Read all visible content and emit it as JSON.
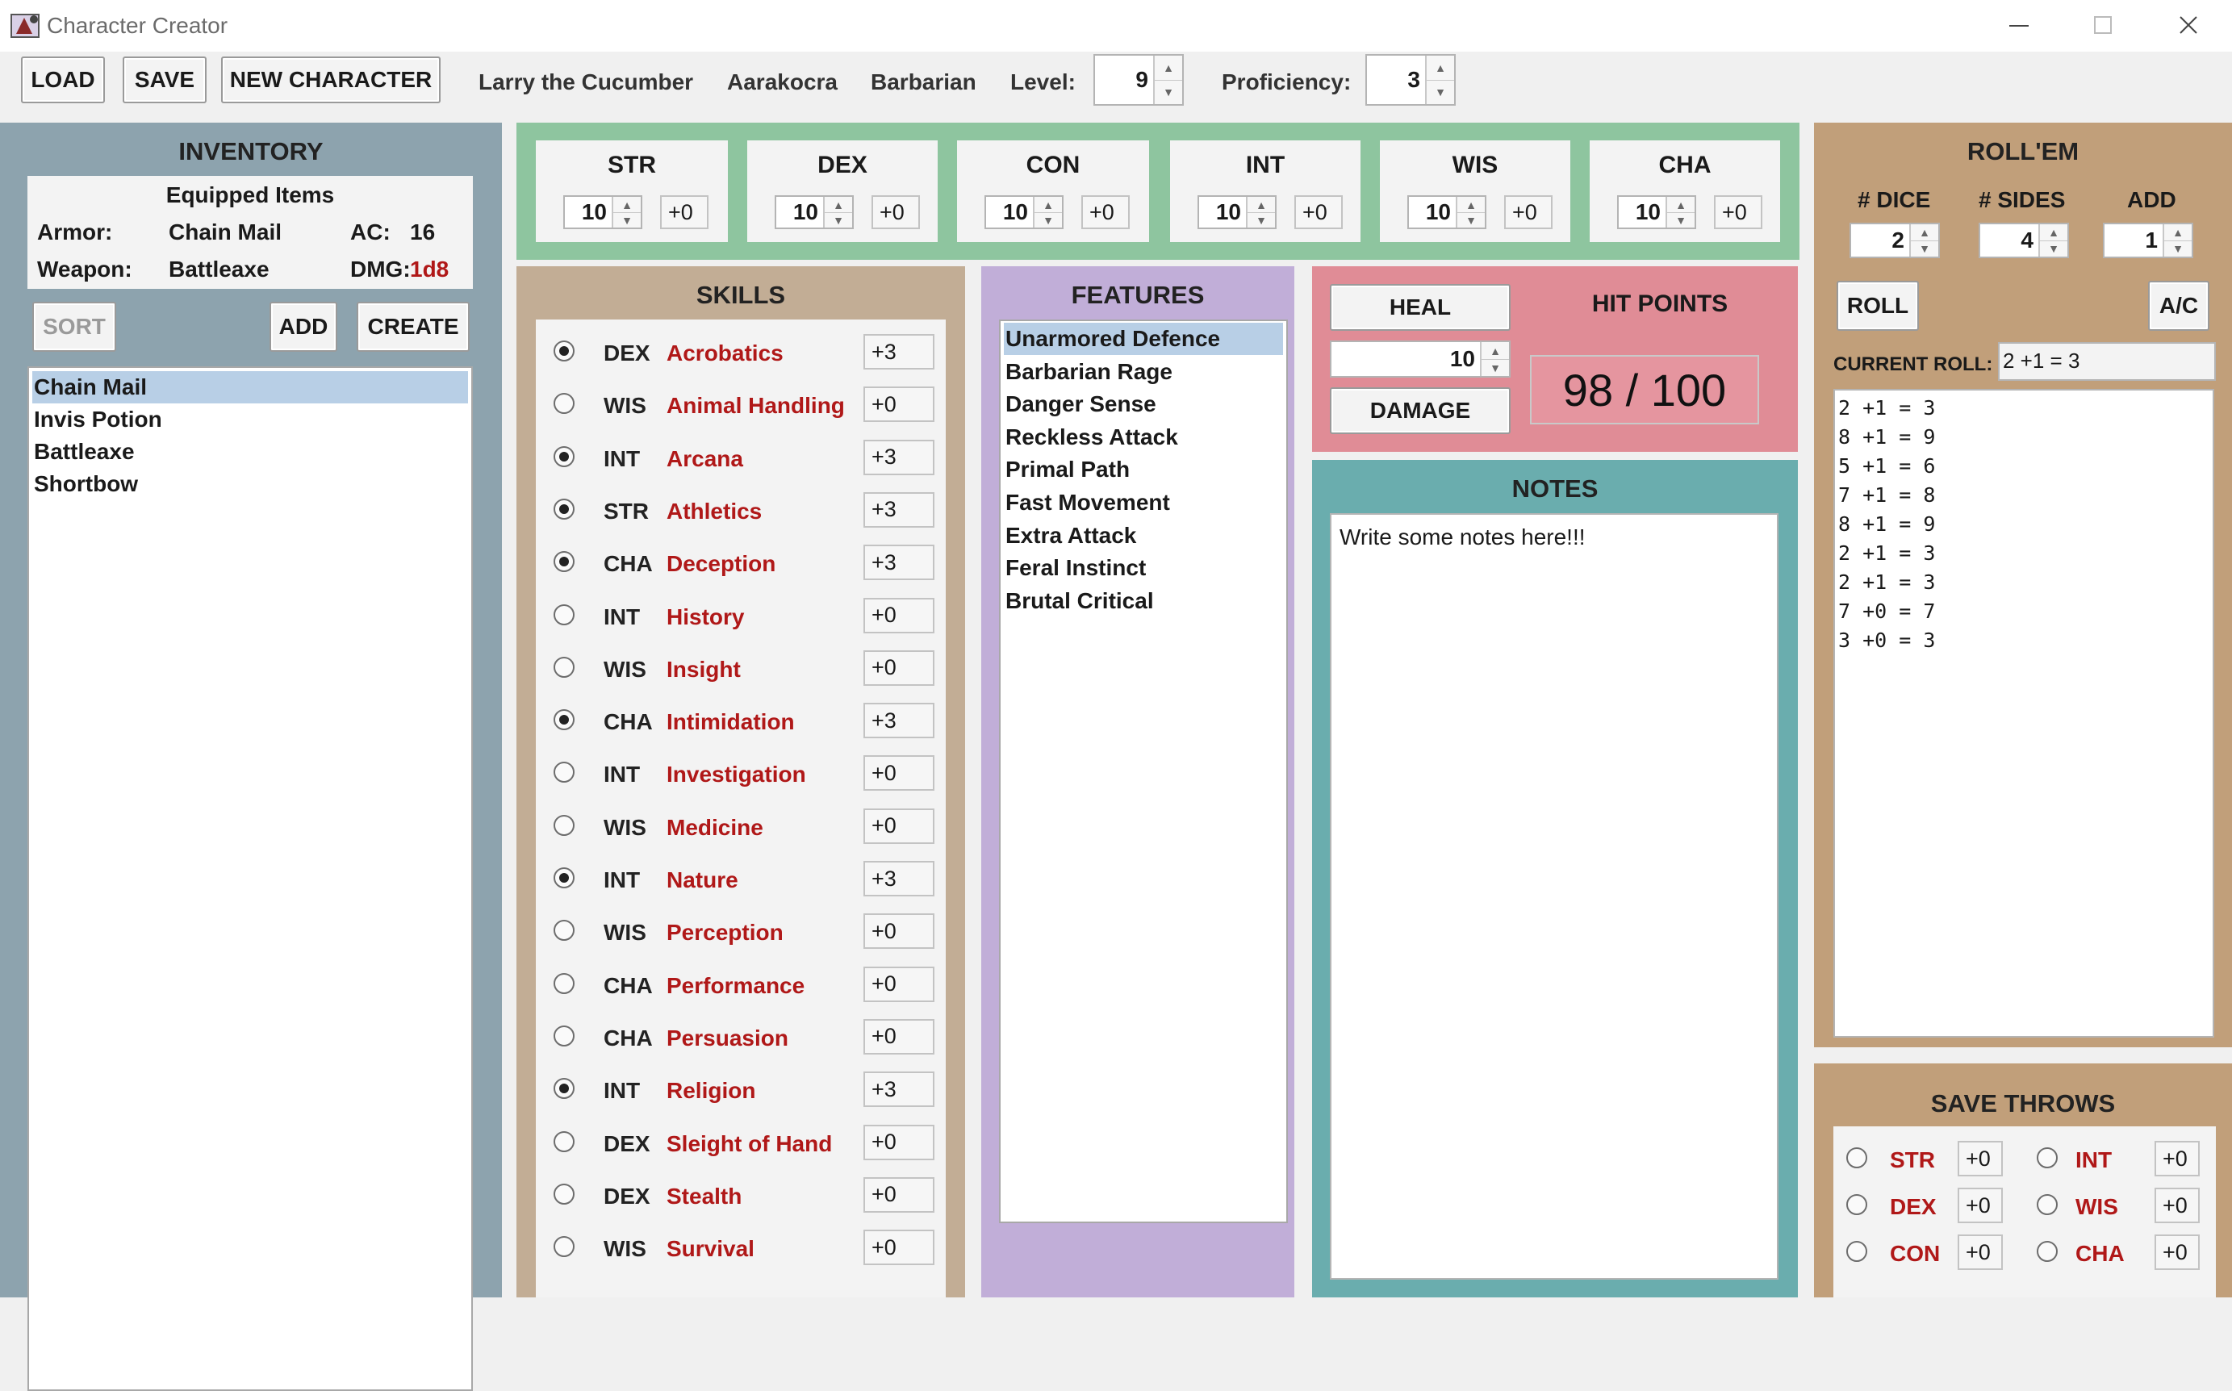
{
  "window": {
    "title": "Character Creator"
  },
  "toolbar": {
    "load": "LOAD",
    "save": "SAVE",
    "new_character": "NEW CHARACTER",
    "name": "Larry the Cucumber",
    "race": "Aarakocra",
    "class": "Barbarian",
    "level_label": "Level:",
    "level": "9",
    "proficiency_label": "Proficiency:",
    "proficiency": "3"
  },
  "inventory": {
    "title": "INVENTORY",
    "equipped_title": "Equipped Items",
    "armor_label": "Armor:",
    "armor": "Chain Mail",
    "ac_label": "AC:",
    "ac": "16",
    "weapon_label": "Weapon:",
    "weapon": "Battleaxe",
    "dmg_label": "DMG:",
    "dmg": "1d8",
    "sort": "SORT",
    "add": "ADD",
    "create": "CREATE",
    "items": [
      "Chain Mail",
      "Invis Potion",
      "Battleaxe",
      "Shortbow"
    ]
  },
  "stats": [
    {
      "name": "STR",
      "value": "10",
      "mod": "+0"
    },
    {
      "name": "DEX",
      "value": "10",
      "mod": "+0"
    },
    {
      "name": "CON",
      "value": "10",
      "mod": "+0"
    },
    {
      "name": "INT",
      "value": "10",
      "mod": "+0"
    },
    {
      "name": "WIS",
      "value": "10",
      "mod": "+0"
    },
    {
      "name": "CHA",
      "value": "10",
      "mod": "+0"
    }
  ],
  "skills": {
    "title": "SKILLS",
    "items": [
      {
        "abbr": "DEX",
        "name": "Acrobatics",
        "mod": "+3",
        "checked": true
      },
      {
        "abbr": "WIS",
        "name": "Animal Handling",
        "mod": "+0",
        "checked": false
      },
      {
        "abbr": "INT",
        "name": "Arcana",
        "mod": "+3",
        "checked": true
      },
      {
        "abbr": "STR",
        "name": "Athletics",
        "mod": "+3",
        "checked": true
      },
      {
        "abbr": "CHA",
        "name": "Deception",
        "mod": "+3",
        "checked": true
      },
      {
        "abbr": "INT",
        "name": "History",
        "mod": "+0",
        "checked": false
      },
      {
        "abbr": "WIS",
        "name": "Insight",
        "mod": "+0",
        "checked": false
      },
      {
        "abbr": "CHA",
        "name": "Intimidation",
        "mod": "+3",
        "checked": true
      },
      {
        "abbr": "INT",
        "name": "Investigation",
        "mod": "+0",
        "checked": false
      },
      {
        "abbr": "WIS",
        "name": "Medicine",
        "mod": "+0",
        "checked": false
      },
      {
        "abbr": "INT",
        "name": "Nature",
        "mod": "+3",
        "checked": true
      },
      {
        "abbr": "WIS",
        "name": "Perception",
        "mod": "+0",
        "checked": false
      },
      {
        "abbr": "CHA",
        "name": "Performance",
        "mod": "+0",
        "checked": false
      },
      {
        "abbr": "CHA",
        "name": "Persuasion",
        "mod": "+0",
        "checked": false
      },
      {
        "abbr": "INT",
        "name": "Religion",
        "mod": "+3",
        "checked": true
      },
      {
        "abbr": "DEX",
        "name": "Sleight of Hand",
        "mod": "+0",
        "checked": false
      },
      {
        "abbr": "DEX",
        "name": "Stealth",
        "mod": "+0",
        "checked": false
      },
      {
        "abbr": "WIS",
        "name": "Survival",
        "mod": "+0",
        "checked": false
      }
    ]
  },
  "features": {
    "title": "FEATURES",
    "items": [
      "Unarmored Defence",
      "Barbarian Rage",
      "Danger Sense",
      "Reckless Attack",
      "Primal Path",
      "Fast Movement",
      "Extra Attack",
      "Feral Instinct",
      "Brutal Critical"
    ]
  },
  "hp": {
    "heal": "HEAL",
    "damage": "DAMAGE",
    "amount": "10",
    "title": "HIT POINTS",
    "display": "98 / 100"
  },
  "notes": {
    "title": "NOTES",
    "text": "Write some notes here!!!"
  },
  "roll": {
    "title": "ROLL'EM",
    "dice_label": "# DICE",
    "dice": "2",
    "sides_label": "# SIDES",
    "sides": "4",
    "add_label": "ADD",
    "add": "1",
    "roll_button": "ROLL",
    "ac_button": "A/C",
    "current_label": "CURRENT ROLL:",
    "current": "2 +1 = 3",
    "history": [
      "2 +1 = 3",
      "8 +1 = 9",
      "5 +1 = 6",
      "7 +1 = 8",
      "8 +1 = 9",
      "2 +1 = 3",
      "2 +1 = 3",
      "7 +0 = 7",
      "3 +0 = 3"
    ]
  },
  "save_throws": {
    "title": "SAVE THROWS",
    "items": [
      {
        "name": "STR",
        "mod": "+0"
      },
      {
        "name": "INT",
        "mod": "+0"
      },
      {
        "name": "DEX",
        "mod": "+0"
      },
      {
        "name": "WIS",
        "mod": "+0"
      },
      {
        "name": "CON",
        "mod": "+0"
      },
      {
        "name": "CHA",
        "mod": "+0"
      }
    ]
  },
  "colors": {
    "inventory_bg": "#8da3ae",
    "stats_bg": "#8ec59f",
    "skills_bg": "#c2ad95",
    "features_bg": "#c1aed8",
    "hp_bg": "#e08c96",
    "notes_bg": "#6aadae",
    "roll_bg": "#c19f7a",
    "accent_red": "#b01818"
  }
}
